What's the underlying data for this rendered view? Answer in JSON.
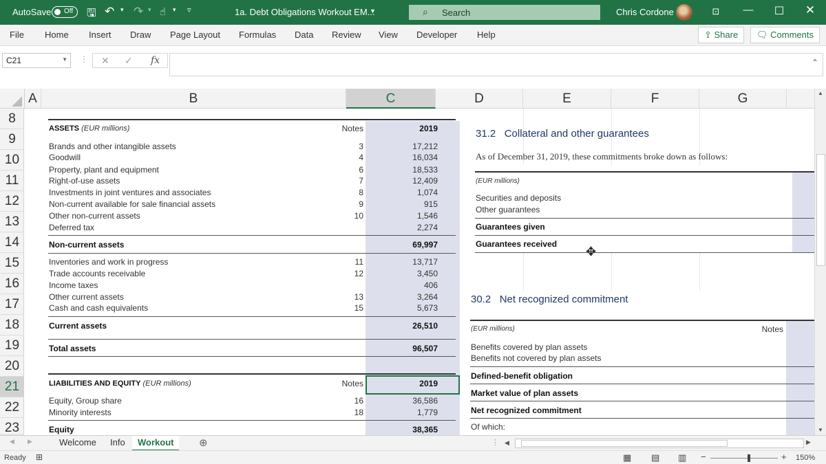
{
  "titlebar": {
    "autosave_label": "AutoSave",
    "autosave_state": "Off",
    "filename": "1a. Debt Obligations Workout EM...",
    "search_placeholder": "Search",
    "user_name": "Chris Cordone",
    "accent_color": "#217346"
  },
  "menu": {
    "items": [
      "File",
      "Home",
      "Insert",
      "Draw",
      "Page Layout",
      "Formulas",
      "Data",
      "Review",
      "View",
      "Developer",
      "Help"
    ],
    "share_label": "Share",
    "comments_label": "Comments"
  },
  "formula_bar": {
    "name_box": "C21",
    "fx_label": "fx",
    "value": ""
  },
  "columns": [
    "A",
    "B",
    "C",
    "D",
    "E",
    "F",
    "G"
  ],
  "rows": [
    "8",
    "9",
    "10",
    "11",
    "12",
    "13",
    "14",
    "15",
    "16",
    "17",
    "18",
    "19",
    "20",
    "21",
    "22",
    "23"
  ],
  "selected_cell": {
    "column": "C",
    "row": "21"
  },
  "assets": {
    "title": "ASSETS",
    "title_unit": "(EUR millions)",
    "notes_header": "Notes",
    "year_header": "2019",
    "non_current_items": [
      {
        "label": "Brands and other intangible assets",
        "note": "3",
        "value": "17,212"
      },
      {
        "label": "Goodwill",
        "note": "4",
        "value": "16,034"
      },
      {
        "label": "Property, plant and equipment",
        "note": "6",
        "value": "18,533"
      },
      {
        "label": "Right-of-use assets",
        "note": "7",
        "value": "12,409"
      },
      {
        "label": "Investments in joint ventures and associates",
        "note": "8",
        "value": "1,074"
      },
      {
        "label": "Non-current available for sale financial assets",
        "note": "9",
        "value": "915"
      },
      {
        "label": "Other non-current assets",
        "note": "10",
        "value": "1,546"
      },
      {
        "label": "Deferred tax",
        "note": "",
        "value": "2,274"
      }
    ],
    "non_current_total": {
      "label": "Non-current assets",
      "value": "69,997"
    },
    "current_items": [
      {
        "label": "Inventories and work in progress",
        "note": "11",
        "value": "13,717"
      },
      {
        "label": "Trade accounts receivable",
        "note": "12",
        "value": "3,450"
      },
      {
        "label": "Income taxes",
        "note": "",
        "value": "406"
      },
      {
        "label": "Other current assets",
        "note": "13",
        "value": "3,264"
      },
      {
        "label": "Cash and cash equivalents",
        "note": "15",
        "value": "5,673"
      }
    ],
    "current_total": {
      "label": "Current assets",
      "value": "26,510"
    },
    "total": {
      "label": "Total assets",
      "value": "96,507"
    }
  },
  "liabilities": {
    "title": "LIABILITIES AND EQUITY",
    "title_unit": "(EUR millions)",
    "notes_header": "Notes",
    "year_header": "2019",
    "items": [
      {
        "label": "Equity, Group share",
        "note": "16",
        "value": "36,586"
      },
      {
        "label": "Minority interests",
        "note": "18",
        "value": "1,779"
      }
    ],
    "equity_total": {
      "label": "Equity",
      "value": "38,365"
    }
  },
  "collateral": {
    "heading_num": "31.2",
    "heading": "Collateral and other guarantees",
    "intro": "As of December 31, 2019, these commitments broke down as follows:",
    "unit": "(EUR millions)",
    "items": [
      "Securities and deposits",
      "Other guarantees"
    ],
    "given_label": "Guarantees given",
    "received_label": "Guarantees received"
  },
  "net_commitment": {
    "heading_num": "30.2",
    "heading": "Net recognized commitment",
    "unit": "(EUR millions)",
    "notes_header": "Notes",
    "items": [
      "Benefits covered by plan assets",
      "Benefits not covered by plan assets"
    ],
    "defined_benefit": "Defined-benefit obligation",
    "market_value": "Market value of plan assets",
    "net_label": "Net recognized commitment",
    "of_which": "Of which:"
  },
  "sheet_tabs": [
    "Welcome",
    "Info",
    "Workout"
  ],
  "active_tab": "Workout",
  "status": {
    "ready": "Ready",
    "zoom": "150%"
  }
}
